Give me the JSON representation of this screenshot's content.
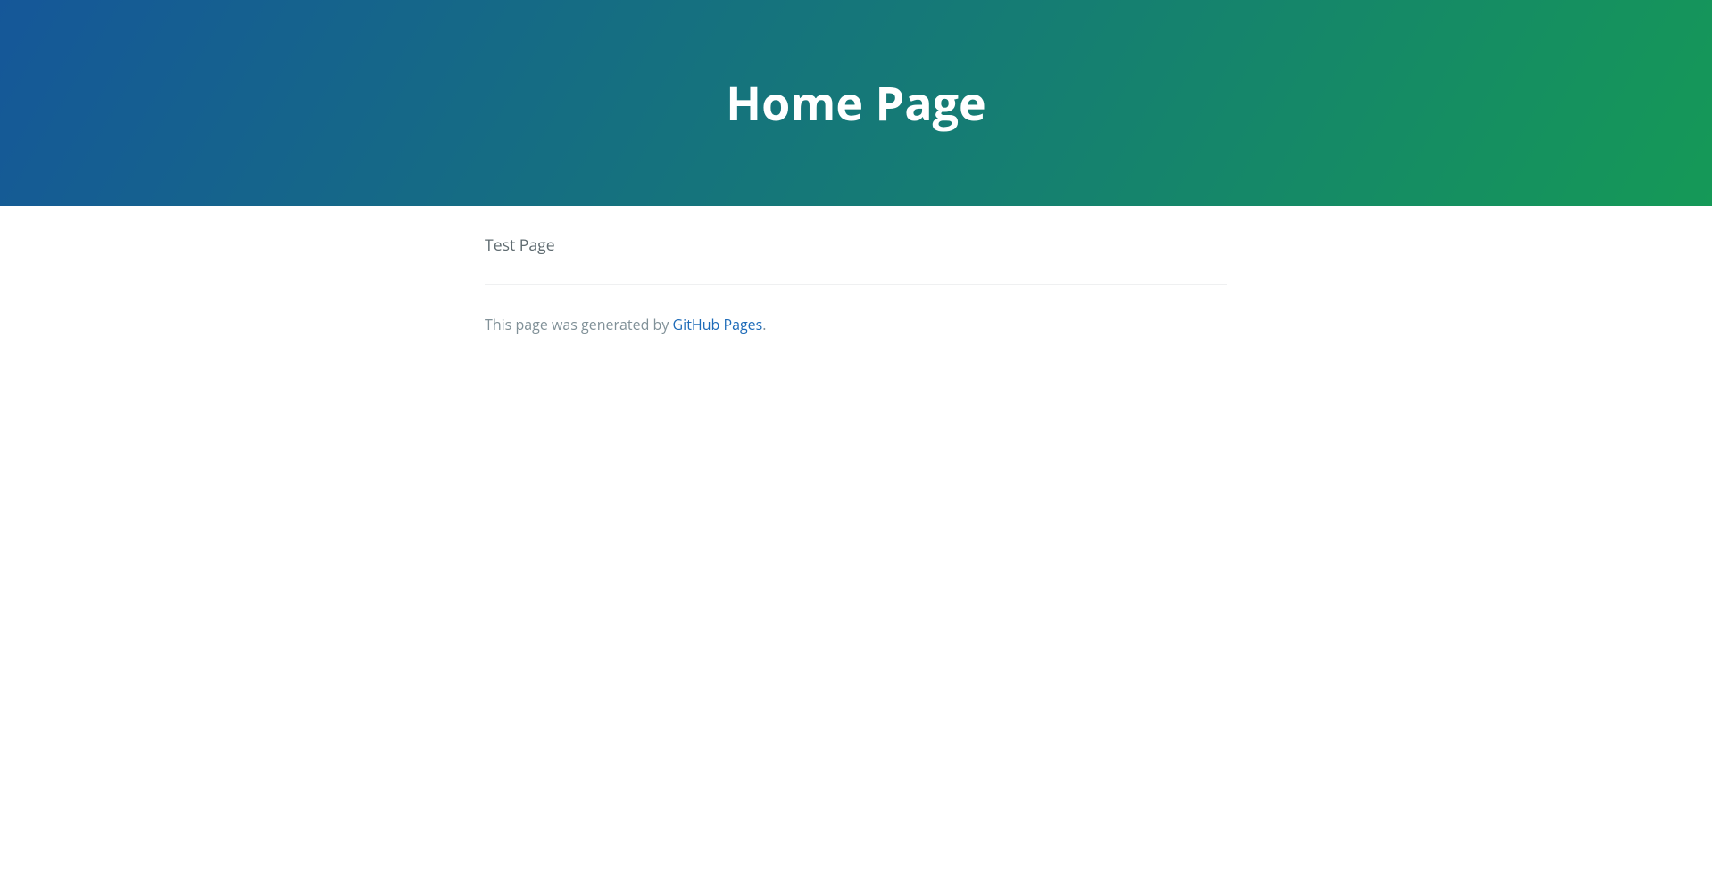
{
  "header": {
    "title": "Home Page"
  },
  "content": {
    "body_text": "Test Page"
  },
  "footer": {
    "prefix": "This page was generated by ",
    "link_text": "GitHub Pages",
    "suffix": "."
  }
}
